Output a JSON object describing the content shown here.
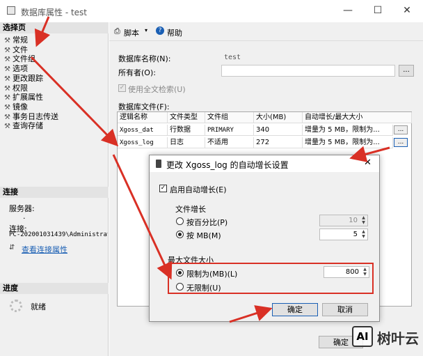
{
  "window": {
    "title": "数据库属性 - test"
  },
  "left": {
    "select_page_header": "选择页",
    "pages": [
      "常规",
      "文件",
      "文件组",
      "选项",
      "更改跟踪",
      "权限",
      "扩展属性",
      "镜像",
      "事务日志传送",
      "查询存储"
    ],
    "connection_header": "连接",
    "server_label": "服务器:",
    "server_value": ".",
    "connection_label": "连接:",
    "connection_value": "PC-202001031439\\Administrat",
    "view_conn_link": "查看连接属性",
    "progress_header": "进度",
    "progress_status": "就绪"
  },
  "toolbar": {
    "script_label": "脚本",
    "help_label": "帮助"
  },
  "form": {
    "db_name_label": "数据库名称(N):",
    "db_name_value": "test",
    "owner_label": "所有者(O):",
    "owner_value": "",
    "owner_button": "...",
    "fulltext_label": "使用全文检索(U)",
    "db_files_label": "数据库文件(F):"
  },
  "grid": {
    "headers": [
      "逻辑名称",
      "文件类型",
      "文件组",
      "大小(MB)",
      "自动增长/最大大小"
    ],
    "rows": [
      [
        "Xgoss_dat",
        "行数据",
        "PRIMARY",
        "340",
        "增量为 5 MB，限制为..."
      ],
      [
        "Xgoss_log",
        "日志",
        "不适用",
        "272",
        "增量为 5 MB，限制为..."
      ]
    ],
    "row_button": "..."
  },
  "dialog": {
    "title": "更改 Xgoss_log 的自动增长设置",
    "enable_autogrow_label": "启用自动增长(E)",
    "file_growth_label": "文件增长",
    "by_percent_label": "按百分比(P)",
    "by_percent_value": "10",
    "by_mb_label": "按 MB(M)",
    "by_mb_value": "5",
    "max_size_label": "最大文件大小",
    "limit_to_label": "限制为(MB)(L)",
    "limit_to_value": "800",
    "unlimited_label": "无限制(U)",
    "ok_label": "确定",
    "cancel_label": "取消"
  },
  "bottom": {
    "ok_partial": "确定"
  },
  "watermark": {
    "text": "树叶云",
    "logo": "AI"
  },
  "colors": {
    "annotation_red": "#d93025",
    "link_blue": "#1a5fb4"
  }
}
